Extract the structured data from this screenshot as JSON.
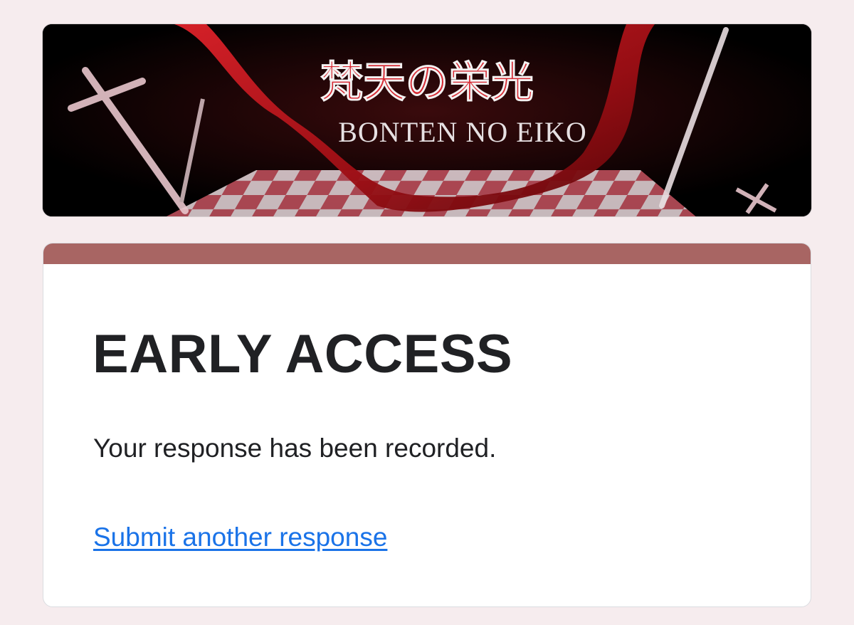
{
  "banner": {
    "title_jp": "梵天の栄光",
    "title_romaji": "BONTEN NO EIKO"
  },
  "form": {
    "title": "EARLY ACCESS",
    "confirmation_message": "Your response has been recorded.",
    "submit_another_label": "Submit another response"
  },
  "colors": {
    "page_background": "#f6ecee",
    "accent": "#a86563",
    "link": "#1a73e8",
    "text": "#202124"
  }
}
